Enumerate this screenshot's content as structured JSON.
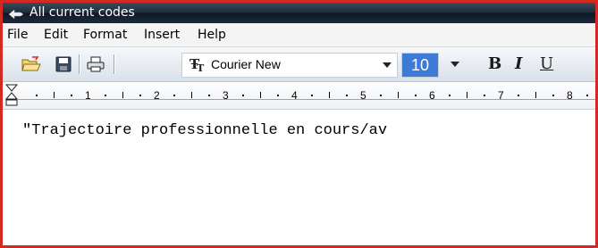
{
  "window": {
    "title": "All current codes"
  },
  "menu": {
    "items": [
      "File",
      "Edit",
      "Format",
      "Insert",
      "Help"
    ]
  },
  "toolbar": {
    "open_icon": "open-folder-icon",
    "save_icon": "save-disk-icon",
    "print_icon": "printer-icon",
    "font_type_icon": "truetype-font-icon",
    "font_name": "Courier New",
    "font_size": "10",
    "bold_label": "B",
    "italic_label": "I",
    "underline_label": "U"
  },
  "ruler": {
    "numbers": [
      "1",
      "2",
      "3",
      "4",
      "5",
      "6",
      "7",
      "8"
    ]
  },
  "editor": {
    "text": "\"Trajectoire professionnelle en cours/av"
  },
  "colors": {
    "border": "#d42a22",
    "titlebar": "#1d2a3a",
    "selection": "#3d7ad6"
  }
}
